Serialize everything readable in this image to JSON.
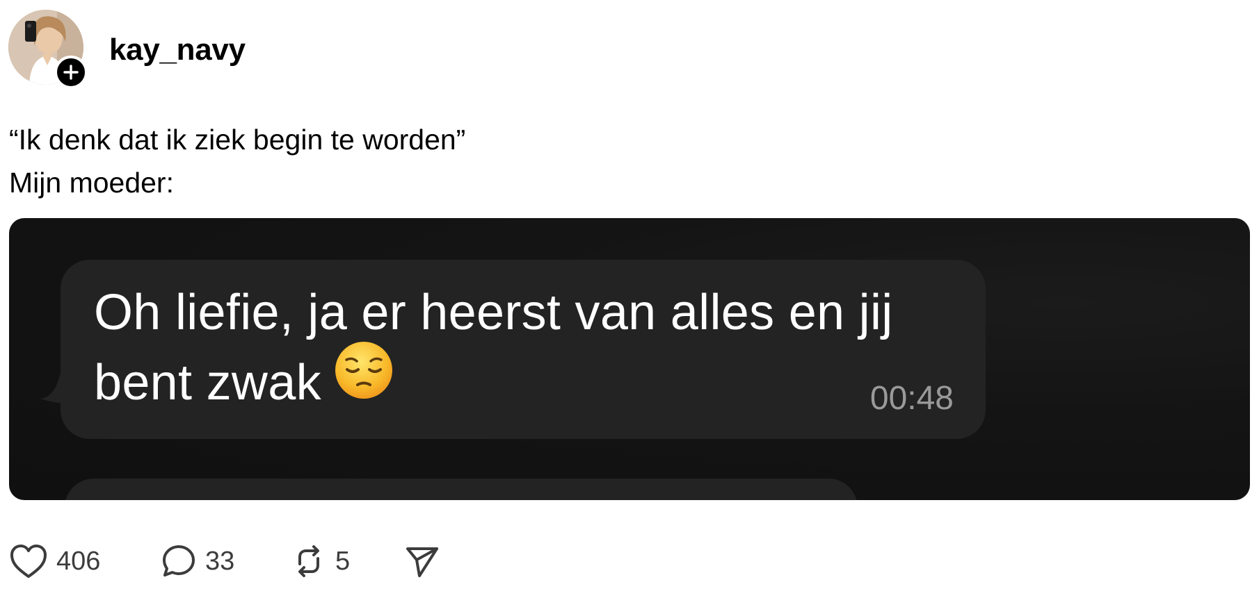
{
  "post": {
    "username": "kay_navy",
    "caption": "“Ik denk dat ik ziek begin te worden”\nMijn moeder:",
    "avatar_alt": "profile-photo",
    "follow_icon": "plus-icon"
  },
  "message": {
    "text": "Oh liefie, ja er heerst van alles en jij bent zwak",
    "emoji": "pensive-face",
    "time": "00:48"
  },
  "actions": {
    "likes": "406",
    "comments": "33",
    "reposts": "5",
    "share_icon": "send-icon"
  },
  "colors": {
    "media_bg": "#121212",
    "bubble_bg": "#232323",
    "time_color": "#9a9a9a"
  }
}
